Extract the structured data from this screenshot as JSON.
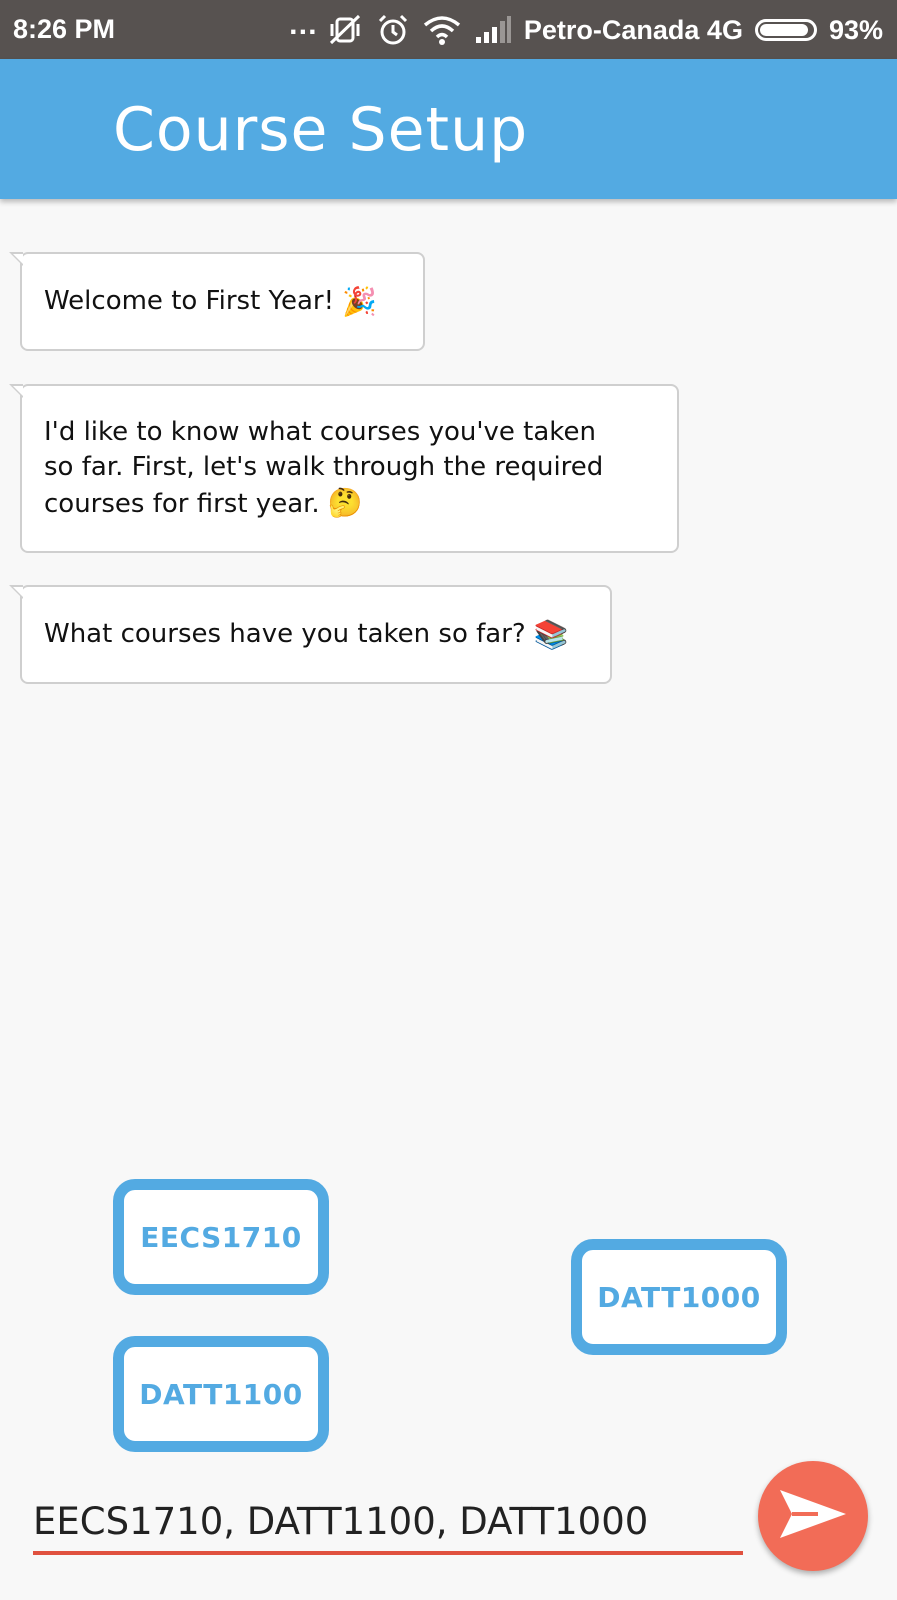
{
  "status_bar": {
    "time": "8:26 PM",
    "carrier": "Petro-Canada 4G",
    "battery": "93%",
    "battery_level": 0.93
  },
  "app_bar": {
    "title": "Course Setup",
    "color": "#53aae2"
  },
  "messages": [
    {
      "text": "Welcome to First Year!",
      "emoji": "🎉"
    },
    {
      "text": "I'd like to know what courses you've taken so far. First, let's walk through the required courses for first year.",
      "emoji": "🤔"
    },
    {
      "text": "What courses have you taken so far?",
      "emoji": "📚"
    }
  ],
  "course_chips": [
    {
      "label": "EECS1710"
    },
    {
      "label": "DATT1000"
    },
    {
      "label": "DATT1100"
    }
  ],
  "input": {
    "value": "EECS1710, DATT1100, DATT1000"
  },
  "send_button": {
    "icon": "send-icon",
    "color": "#f26c57"
  }
}
